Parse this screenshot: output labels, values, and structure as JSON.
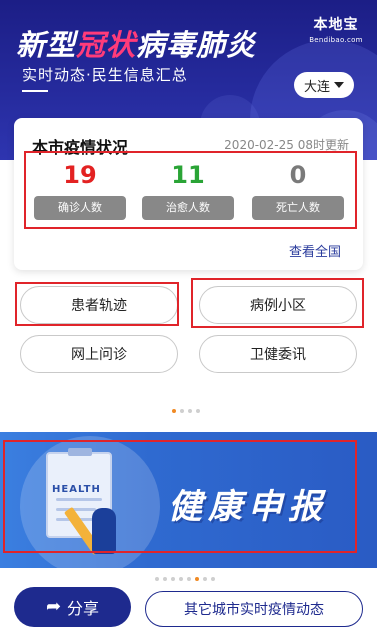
{
  "header": {
    "title_part1": "新型",
    "title_highlight": "冠状",
    "title_part2": "病毒肺炎",
    "subtitle": "实时动态·民生信息汇总",
    "logo_cn": "本地宝",
    "logo_en": "Bendibao.com",
    "city": "大连"
  },
  "card": {
    "title": "本市疫情状况",
    "updated": "2020-02-25 08时更新",
    "stats": [
      {
        "value": "19",
        "label": "确诊人数",
        "color": "#e32222"
      },
      {
        "value": "11",
        "label": "治愈人数",
        "color": "#2aa436"
      },
      {
        "value": "0",
        "label": "死亡人数",
        "color": "#7a7a7a"
      }
    ],
    "view_all": "查看全国"
  },
  "quick_links": [
    {
      "label": "患者轨迹"
    },
    {
      "label": "病例小区"
    },
    {
      "label": "网上问诊"
    },
    {
      "label": "卫健委讯"
    }
  ],
  "health_banner": {
    "tag": "HEALTH",
    "title": "健康申报"
  },
  "footer": {
    "share_label": "分享",
    "other_cities_label": "其它城市实时疫情动态"
  },
  "colors": {
    "banner_bg": "#1c1e86",
    "highlight": "#e0242a",
    "accent_blue": "#1e2a8e"
  }
}
